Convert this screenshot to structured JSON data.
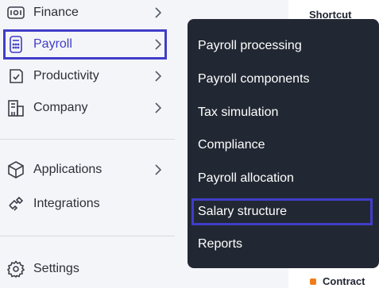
{
  "sidebar": {
    "items": [
      {
        "label": "Finance",
        "icon": "finance-icon"
      },
      {
        "label": "Payroll",
        "icon": "payroll-icon",
        "active": true
      },
      {
        "label": "Productivity",
        "icon": "productivity-icon"
      },
      {
        "label": "Company",
        "icon": "company-icon"
      },
      {
        "label": "Applications",
        "icon": "applications-icon"
      },
      {
        "label": "Integrations",
        "icon": "integrations-icon"
      },
      {
        "label": "Settings",
        "icon": "gear-icon"
      }
    ]
  },
  "dropdown": {
    "items": [
      "Payroll processing",
      "Payroll components",
      "Tax simulation",
      "Compliance",
      "Payroll allocation",
      "Salary structure",
      "Reports"
    ],
    "highlighted": "Salary structure"
  },
  "right_panel": {
    "title": "Shortcut",
    "item_label": "Contract"
  },
  "colors": {
    "highlight_border": "#3f3dc8",
    "dropdown_bg": "#222833",
    "contract_dot": "#f07c1a"
  }
}
